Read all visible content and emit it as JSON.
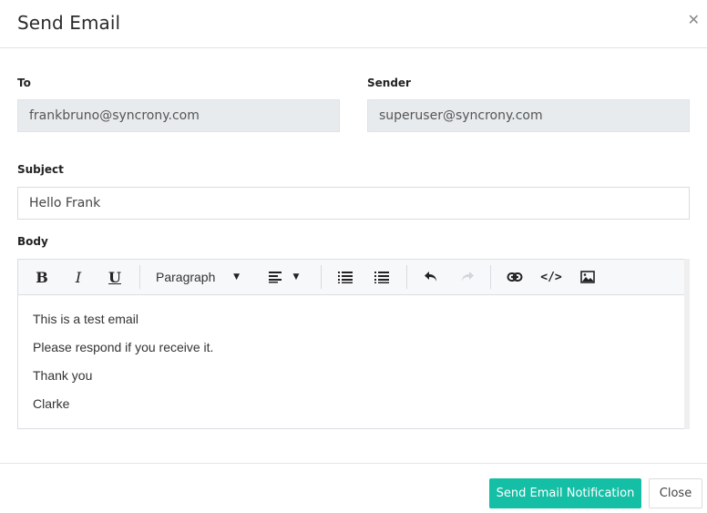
{
  "dialog": {
    "title": "Send Email",
    "close_icon": "close-icon"
  },
  "form": {
    "to": {
      "label": "To",
      "value": "frankbruno@syncrony.com"
    },
    "sender": {
      "label": "Sender",
      "value": "superuser@syncrony.com"
    },
    "subject": {
      "label": "Subject",
      "value": "Hello Frank"
    },
    "body": {
      "label": "Body",
      "toolbar": {
        "bold": "B",
        "italic": "I",
        "underline": "U",
        "block_format": "Paragraph",
        "icons": [
          "bold-icon",
          "italic-icon",
          "underline-icon",
          "block-format-dropdown",
          "align-left-icon",
          "bullet-list-icon",
          "numbered-list-icon",
          "undo-icon",
          "redo-icon",
          "link-icon",
          "code-icon",
          "image-icon"
        ]
      },
      "lines": [
        "This is a test email",
        "Please respond if you receive it.",
        "Thank you",
        "Clarke"
      ]
    }
  },
  "footer": {
    "send_label": "Send Email Notification",
    "close_label": "Close",
    "accent_color": "#14bfa5"
  }
}
